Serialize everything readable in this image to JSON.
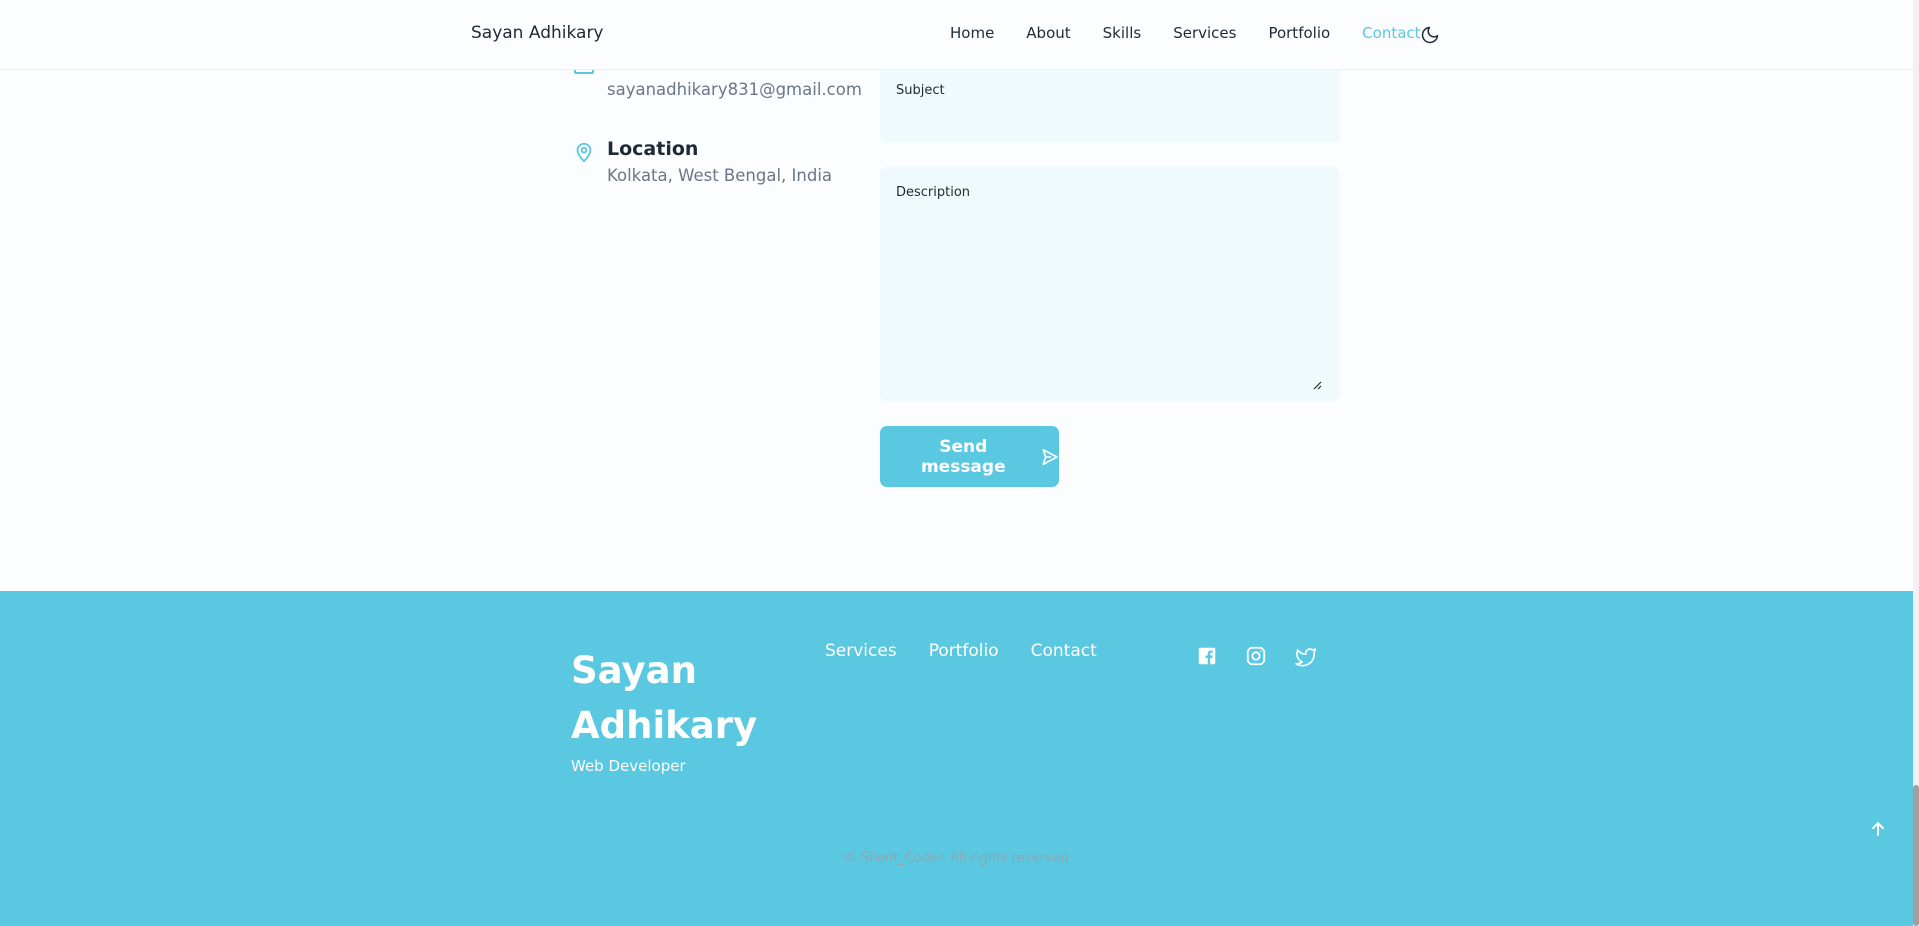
{
  "header": {
    "logo": "Sayan Adhikary",
    "nav": [
      "Home",
      "About",
      "Skills",
      "Services",
      "Portfolio",
      "Contact"
    ],
    "active_nav": "Contact",
    "theme_icon": "moon-icon"
  },
  "contact_info": {
    "email_value": "sayanadhikary831@gmail.com",
    "location_title": "Location",
    "location_value": "Kolkata, West Bengal, India"
  },
  "form": {
    "subject_label": "Subject",
    "description_label": "Description",
    "send_label": "Send message"
  },
  "footer": {
    "title": "Sayan Adhikary",
    "subtitle": "Web Developer",
    "links": [
      "Services",
      "Portfolio",
      "Contact"
    ],
    "social_icons": [
      "facebook-icon",
      "instagram-icon",
      "twitter-icon"
    ],
    "copyright": "© Silent_Coder. All rights reserved"
  },
  "colors": {
    "accent": "#5ac8e0",
    "page_bg": "#fbfdfe",
    "field_bg": "#eefafb",
    "text_dark": "#1f2a36",
    "text_muted": "#6b7686"
  }
}
